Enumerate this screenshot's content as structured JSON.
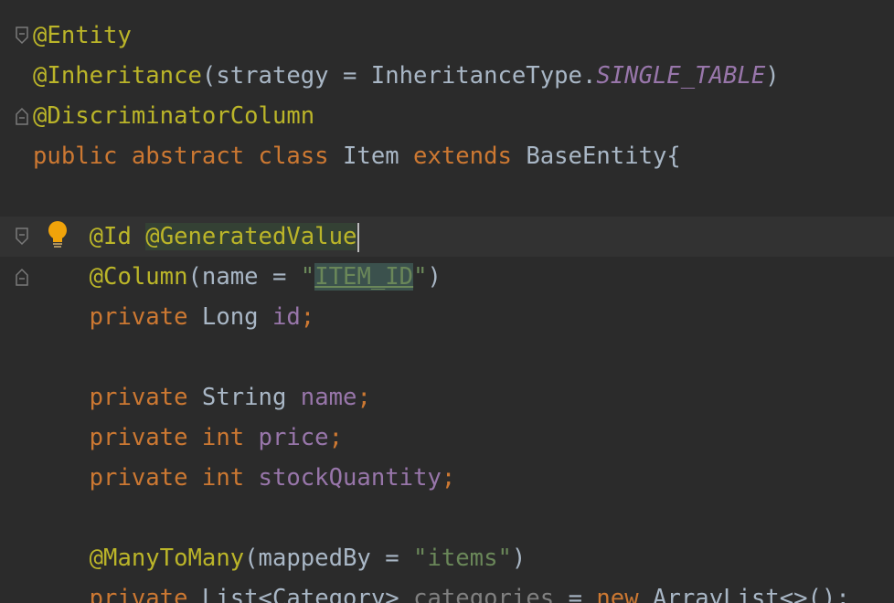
{
  "editor": {
    "lines": [
      {
        "tokens": [
          {
            "t": "@Entity",
            "c": "ann"
          }
        ]
      },
      {
        "tokens": [
          {
            "t": "@Inheritance",
            "c": "ann"
          },
          {
            "t": "(strategy = InheritanceType.",
            "c": "id"
          },
          {
            "t": "SINGLE_TABLE",
            "c": "cnst"
          },
          {
            "t": ")",
            "c": "id"
          }
        ]
      },
      {
        "tokens": [
          {
            "t": "@DiscriminatorColumn",
            "c": "ann"
          }
        ]
      },
      {
        "tokens": [
          {
            "t": "public abstract class ",
            "c": "kw"
          },
          {
            "t": "Item ",
            "c": "id"
          },
          {
            "t": "extends ",
            "c": "kw"
          },
          {
            "t": "BaseEntity{",
            "c": "id"
          }
        ]
      },
      {
        "tokens": []
      },
      {
        "tokens": [
          {
            "t": "    ",
            "c": "id"
          },
          {
            "t": "@Id ",
            "c": "ann"
          },
          {
            "t": "@GeneratedValue",
            "c": "ann hl-ann"
          }
        ]
      },
      {
        "tokens": [
          {
            "t": "    ",
            "c": "id"
          },
          {
            "t": "@Column",
            "c": "ann"
          },
          {
            "t": "(name = ",
            "c": "id"
          },
          {
            "t": "\"",
            "c": "str"
          },
          {
            "t": "ITEM_ID",
            "c": "str link"
          },
          {
            "t": "\"",
            "c": "str"
          },
          {
            "t": ")",
            "c": "id"
          }
        ]
      },
      {
        "tokens": [
          {
            "t": "    ",
            "c": "id"
          },
          {
            "t": "private ",
            "c": "kw"
          },
          {
            "t": "Long ",
            "c": "id"
          },
          {
            "t": "id",
            "c": "fld"
          },
          {
            "t": ";",
            "c": "kw"
          }
        ]
      },
      {
        "tokens": []
      },
      {
        "tokens": [
          {
            "t": "    ",
            "c": "id"
          },
          {
            "t": "private ",
            "c": "kw"
          },
          {
            "t": "String ",
            "c": "id"
          },
          {
            "t": "name",
            "c": "fld"
          },
          {
            "t": ";",
            "c": "kw"
          }
        ]
      },
      {
        "tokens": [
          {
            "t": "    ",
            "c": "id"
          },
          {
            "t": "private int ",
            "c": "kw"
          },
          {
            "t": "price",
            "c": "fld"
          },
          {
            "t": ";",
            "c": "kw"
          }
        ]
      },
      {
        "tokens": [
          {
            "t": "    ",
            "c": "id"
          },
          {
            "t": "private int ",
            "c": "kw"
          },
          {
            "t": "stockQuantity",
            "c": "fld"
          },
          {
            "t": ";",
            "c": "kw"
          }
        ]
      },
      {
        "tokens": []
      },
      {
        "tokens": [
          {
            "t": "    ",
            "c": "id"
          },
          {
            "t": "@ManyToMany",
            "c": "ann"
          },
          {
            "t": "(mappedBy = ",
            "c": "id"
          },
          {
            "t": "\"items\"",
            "c": "str"
          },
          {
            "t": ")",
            "c": "id"
          }
        ]
      },
      {
        "tokens": [
          {
            "t": "    ",
            "c": "id"
          },
          {
            "t": "private ",
            "c": "kw"
          },
          {
            "t": "List<Category> ",
            "c": "id"
          },
          {
            "t": "categories ",
            "c": "gray"
          },
          {
            "t": "= ",
            "c": "id"
          },
          {
            "t": "new ",
            "c": "kw"
          },
          {
            "t": "ArrayList<>();",
            "c": "id"
          }
        ]
      }
    ],
    "current_line": 5,
    "caret_after_line": 5,
    "fold_markers": [
      0,
      2,
      5,
      6
    ],
    "bulb_line": 5,
    "colors": {
      "background": "#2b2b2b",
      "annotation": "#bbb529",
      "keyword": "#cc7832",
      "string": "#6a8759",
      "field": "#9876aa",
      "text": "#a9b7c6",
      "bulb": "#f0a30a"
    },
    "icons": {
      "fold": "fold-marker-icon",
      "intention": "lightbulb-icon"
    }
  }
}
